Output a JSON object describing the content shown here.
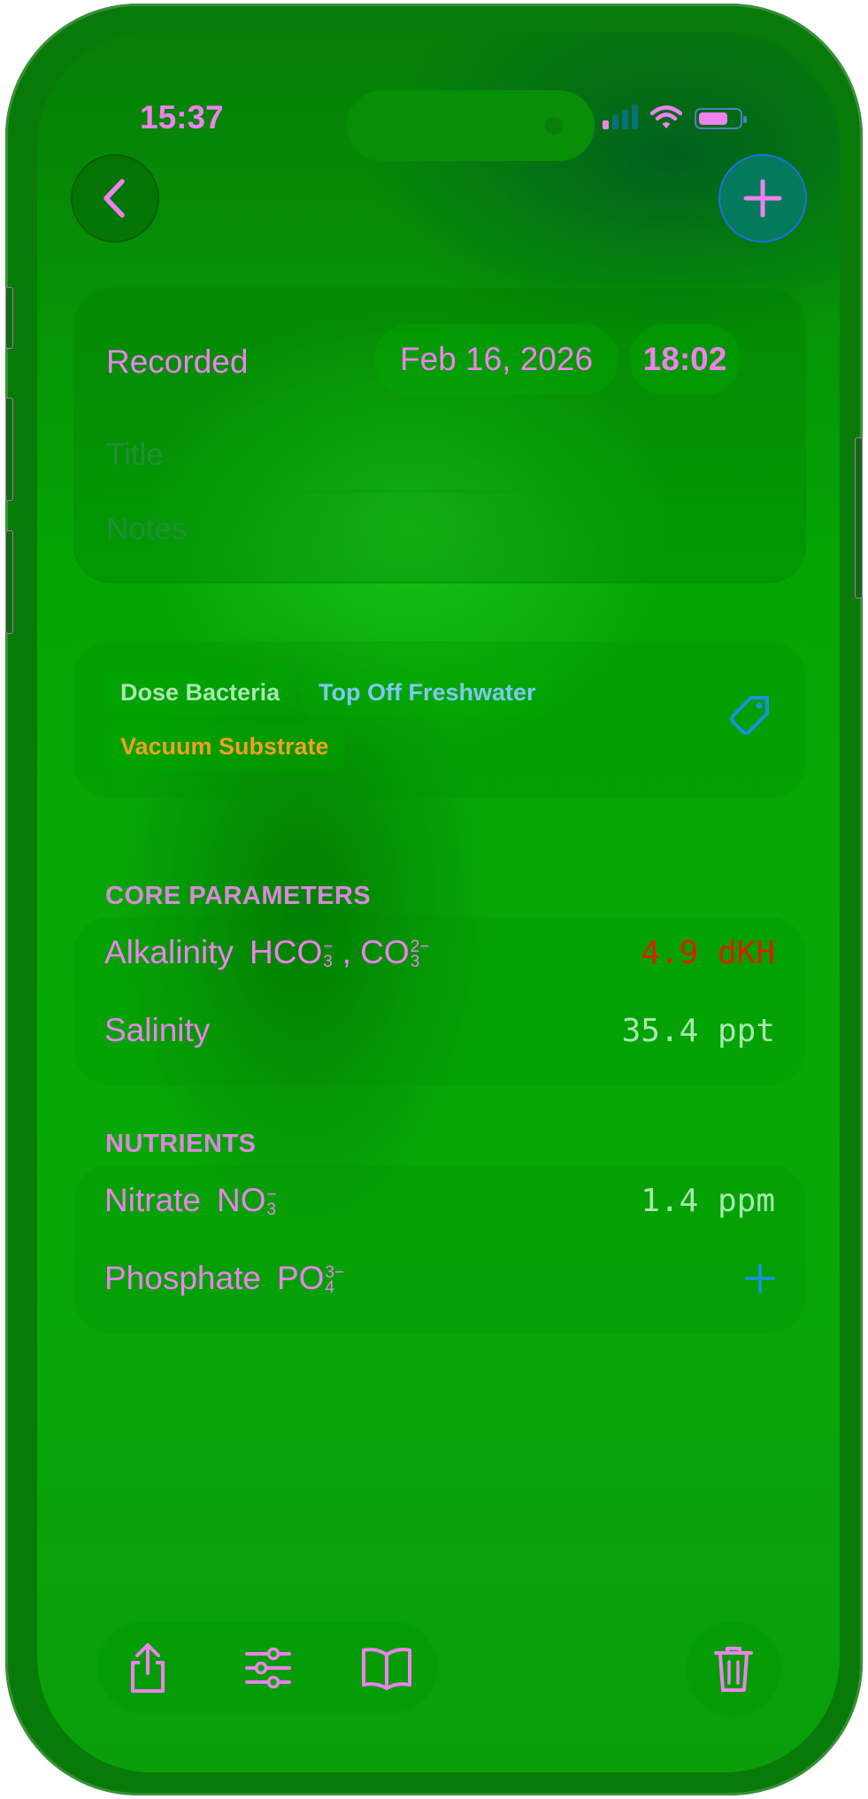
{
  "status_bar": {
    "time": "15:37",
    "signal_bars_active": 1,
    "battery_level": 0.72
  },
  "nav": {
    "back_icon": "chevron-left-icon",
    "add_icon": "plus-icon"
  },
  "record": {
    "recorded_label": "Recorded",
    "date": "Feb 16, 2026",
    "time": "18:02",
    "title_placeholder": "Title",
    "notes_placeholder": "Notes"
  },
  "tags": {
    "items": [
      {
        "label": "Dose Bacteria",
        "color": "#a8e8b0"
      },
      {
        "label": "Top Off Freshwater",
        "color": "#7ec8f0"
      },
      {
        "label": "Vacuum Substrate",
        "color": "#f0a020"
      }
    ],
    "tag_icon": "tag-icon"
  },
  "core_parameters": {
    "header": "CORE PARAMETERS",
    "rows": [
      {
        "name": "Alkalinity",
        "formula": "HCO3−, CO3 2−",
        "value": "4.9 dKH",
        "value_color": "#d82000"
      },
      {
        "name": "Salinity",
        "value": "35.4 ppt",
        "value_color": "#a8e8b0"
      }
    ]
  },
  "nutrients": {
    "header": "NUTRIENTS",
    "rows": [
      {
        "name": "Nitrate",
        "formula": "NO3−",
        "value": "1.4 ppm",
        "value_color": "#a8e8b0"
      },
      {
        "name": "Phosphate",
        "formula": "PO4 3−",
        "action_icon": "plus-icon"
      }
    ]
  },
  "bottom_toolbar": {
    "items": [
      "share-icon",
      "sliders-icon",
      "book-icon"
    ],
    "delete_icon": "trash-icon"
  },
  "colors": {
    "accent": "#ee82ee",
    "background": "#06a806",
    "link_blue": "#1e8fe0",
    "alert_red": "#d82000"
  }
}
